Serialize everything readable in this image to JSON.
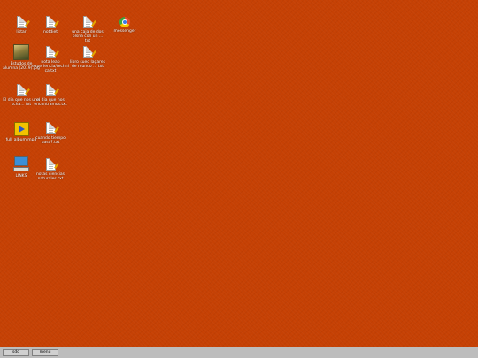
{
  "desktop": {
    "icons": [
      {
        "label": "listar",
        "kind": "document"
      },
      {
        "label": "notdiet",
        "kind": "document"
      },
      {
        "label": "una caja de dos plsna con un ... txt",
        "kind": "document"
      },
      {
        "label": "messenger",
        "kind": "browser"
      },
      {
        "label": "Estudos de alumna (2019).jpg",
        "kind": "image"
      },
      {
        "label": "nota leap experiencia/technica.txt",
        "kind": "document"
      },
      {
        "label": "libro sueo lagares de mundo ... txt",
        "kind": "document"
      },
      {
        "label": "El dia que nos una scha... txt",
        "kind": "document"
      },
      {
        "label": "el dia que nos encontramos.txt",
        "kind": "document"
      },
      {
        "label": "full_album.mp3",
        "kind": "media"
      },
      {
        "label": "cuando tiempo paso?.txt",
        "kind": "document"
      },
      {
        "label": "LINKS",
        "kind": "computer"
      },
      {
        "label": "notas ciencias naturales.txt",
        "kind": "document"
      }
    ]
  },
  "taskbar": {
    "buttons": [
      {
        "label": "sdo"
      },
      {
        "label": "menu"
      }
    ]
  },
  "colors": {
    "desktop_background": "#c64104",
    "taskbar": "#bdbdbd",
    "icon_label": "#ffffff"
  }
}
